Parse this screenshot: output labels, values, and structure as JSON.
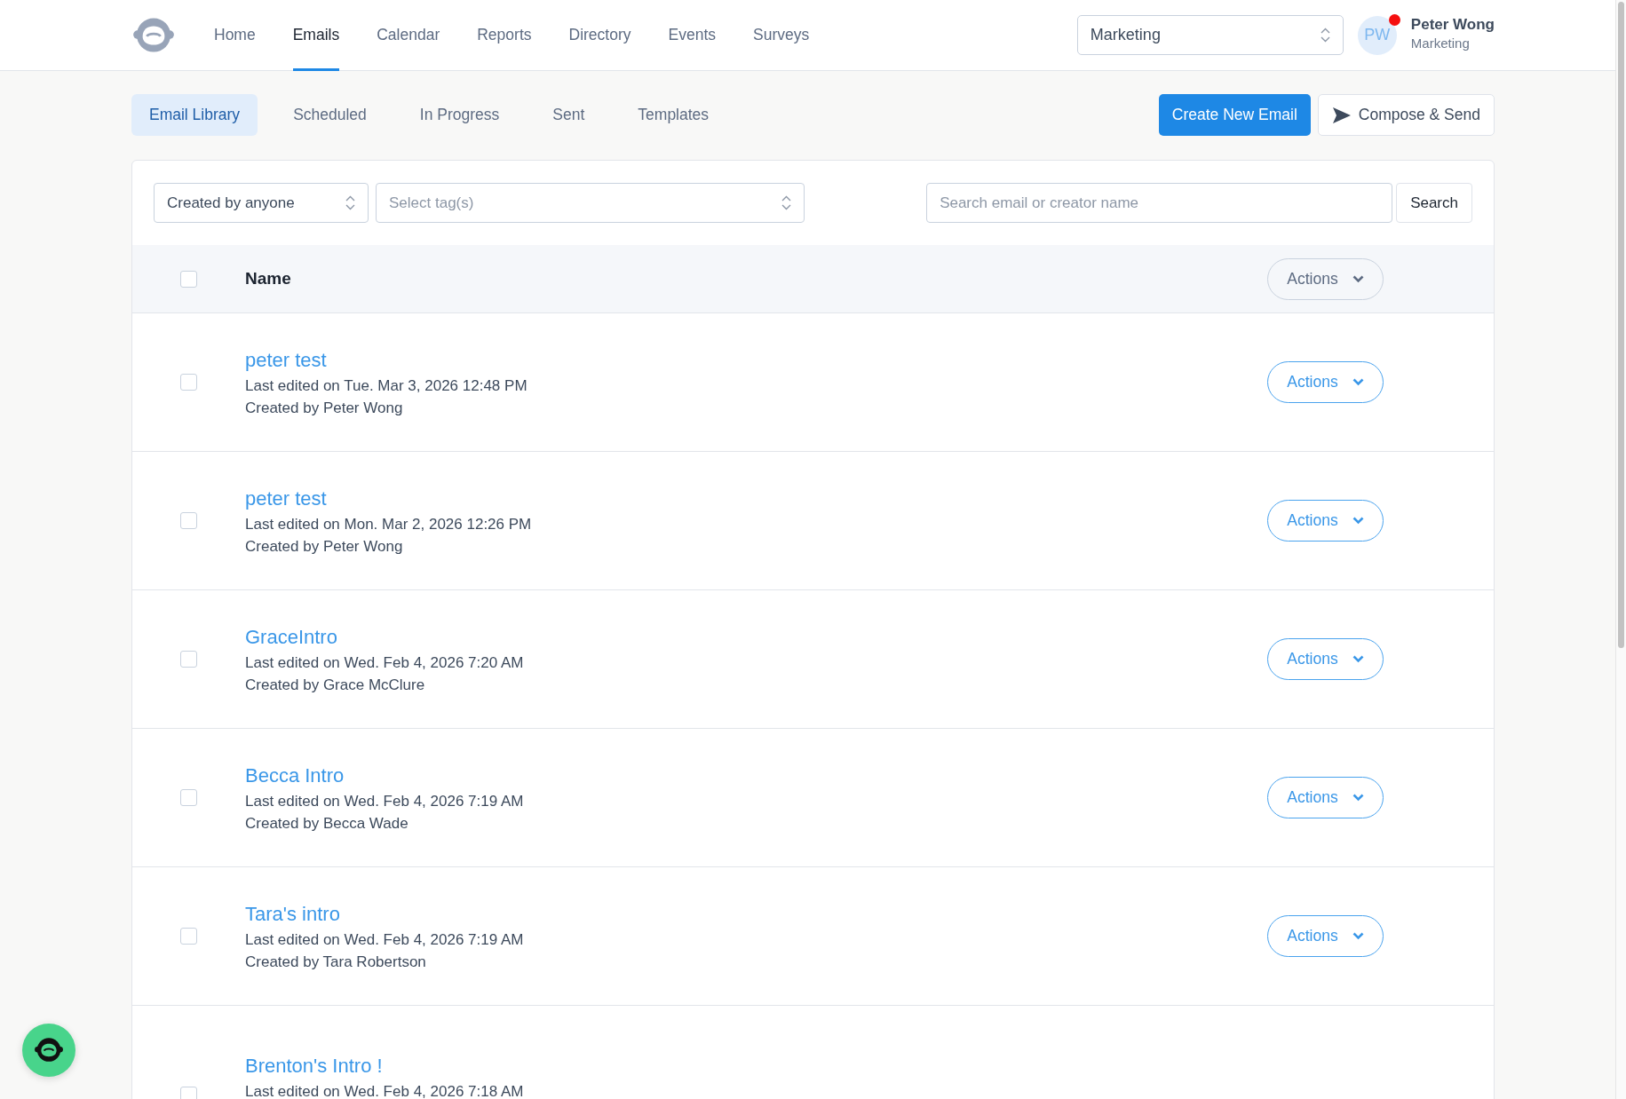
{
  "nav": {
    "items": [
      {
        "label": "Home",
        "selected": false
      },
      {
        "label": "Emails",
        "selected": true
      },
      {
        "label": "Calendar",
        "selected": false
      },
      {
        "label": "Reports",
        "selected": false
      },
      {
        "label": "Directory",
        "selected": false
      },
      {
        "label": "Events",
        "selected": false
      },
      {
        "label": "Surveys",
        "selected": false
      }
    ]
  },
  "org_select": {
    "value": "Marketing"
  },
  "user": {
    "initials": "PW",
    "name": "Peter Wong",
    "role": "Marketing",
    "notification": true
  },
  "tabs": [
    {
      "label": "Email Library",
      "selected": true
    },
    {
      "label": "Scheduled",
      "selected": false
    },
    {
      "label": "In Progress",
      "selected": false
    },
    {
      "label": "Sent",
      "selected": false
    },
    {
      "label": "Templates",
      "selected": false
    }
  ],
  "buttons": {
    "create": "Create New Email",
    "compose": "Compose & Send"
  },
  "filters": {
    "creator": {
      "value": "Created by anyone"
    },
    "tags": {
      "placeholder": "Select tag(s)"
    },
    "search": {
      "placeholder": "Search email or creator name"
    },
    "search_button": "Search"
  },
  "table": {
    "header": {
      "checked": false,
      "column": "Name",
      "actions": "Actions"
    },
    "rows": [
      {
        "title": "peter test",
        "edited": "Last edited on Tue. Mar 3, 2026 12:48 PM",
        "creator": "Created by Peter Wong",
        "checked": false,
        "actions": "Actions"
      },
      {
        "title": "peter test",
        "edited": "Last edited on Mon. Mar 2, 2026 12:26 PM",
        "creator": "Created by Peter Wong",
        "checked": false,
        "actions": "Actions"
      },
      {
        "title": "GraceIntro",
        "edited": "Last edited on Wed. Feb 4, 2026 7:20 AM",
        "creator": "Created by Grace McClure",
        "checked": false,
        "actions": "Actions"
      },
      {
        "title": "Becca Intro",
        "edited": "Last edited on Wed. Feb 4, 2026 7:19 AM",
        "creator": "Created by Becca Wade",
        "checked": false,
        "actions": "Actions"
      },
      {
        "title": "Tara's intro",
        "edited": "Last edited on Wed. Feb 4, 2026 7:19 AM",
        "creator": "Created by Tara Robertson",
        "checked": false,
        "actions": "Actions"
      },
      {
        "title": "Brenton's Intro !",
        "edited": "Last edited on Wed. Feb 4, 2026 7:18 AM",
        "checked": false
      }
    ]
  }
}
